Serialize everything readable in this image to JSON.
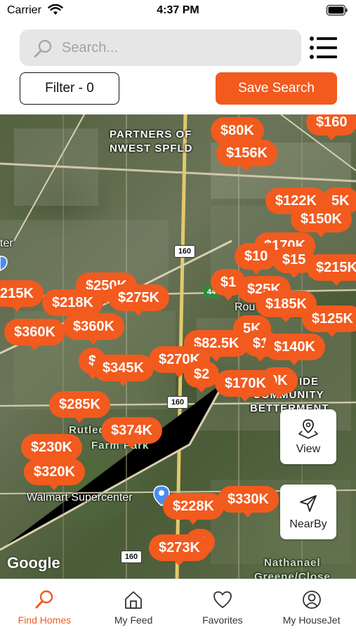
{
  "status_bar": {
    "carrier": "Carrier",
    "time": "4:37 PM"
  },
  "search": {
    "placeholder": "Search..."
  },
  "filter": {
    "label": "Filter  - 0"
  },
  "save_search": {
    "label": "Save Search"
  },
  "map": {
    "labels": {
      "partners_line1": "PARTNERS OF",
      "partners_line2": "NWEST SPFLD",
      "ter": "ter",
      "rou": "Rou",
      "ide": "IDE",
      "community": "COMMUNITY",
      "betterment": "BETTERMENT",
      "rutled": "Rutled",
      "farm_park": "Farm Park",
      "walmart": "Walmart Supercenter",
      "nathanael": "Nathanael",
      "greene_close": "Greene/Close"
    },
    "highways": {
      "h160_a": "160",
      "h160_b": "160",
      "h160_c": "160",
      "h44": "44"
    },
    "attribution": "Google",
    "pins": [
      {
        "id": "p1",
        "price": "$80K"
      },
      {
        "id": "p2",
        "price": "$160"
      },
      {
        "id": "p3",
        "price": "$156K"
      },
      {
        "id": "p4",
        "price": "$122K"
      },
      {
        "id": "p5",
        "price": "5K"
      },
      {
        "id": "p6",
        "price": "$150K"
      },
      {
        "id": "p7",
        "price": "$170K"
      },
      {
        "id": "p8",
        "price": "$10"
      },
      {
        "id": "p9",
        "price": "$15"
      },
      {
        "id": "p10",
        "price": "$215K"
      },
      {
        "id": "p11",
        "price": "$250K"
      },
      {
        "id": "p12",
        "price": "$1"
      },
      {
        "id": "p13",
        "price": "$25K"
      },
      {
        "id": "p14",
        "price": "215K"
      },
      {
        "id": "p15",
        "price": "$218K"
      },
      {
        "id": "p16",
        "price": "$275K"
      },
      {
        "id": "p17",
        "price": "$185K"
      },
      {
        "id": "p18",
        "price": "$125K"
      },
      {
        "id": "p19",
        "price": "$360K"
      },
      {
        "id": "p20",
        "price": "$360K"
      },
      {
        "id": "p21",
        "price": "5K"
      },
      {
        "id": "p22",
        "price": "$82.5K"
      },
      {
        "id": "p23",
        "price": "$1"
      },
      {
        "id": "p24",
        "price": "$140K"
      },
      {
        "id": "p25",
        "price": "$"
      },
      {
        "id": "p26",
        "price": "$345K"
      },
      {
        "id": "p27",
        "price": "$270K"
      },
      {
        "id": "p28",
        "price": "$2"
      },
      {
        "id": "p29",
        "price": "0K"
      },
      {
        "id": "p30",
        "price": "$170K"
      },
      {
        "id": "p31",
        "price": "$285K"
      },
      {
        "id": "p32",
        "price": "$374K"
      },
      {
        "id": "p33",
        "price": "$230K"
      },
      {
        "id": "p34",
        "price": "$320K"
      },
      {
        "id": "p35",
        "price": "$330K"
      },
      {
        "id": "p36",
        "price": "$228K"
      },
      {
        "id": "p37",
        "price": "K"
      },
      {
        "id": "p38",
        "price": "$273K"
      }
    ],
    "view_button": {
      "label": "View",
      "icon": "layers-icon"
    },
    "nearby_button": {
      "label": "NearBy",
      "icon": "navigation-arrow-icon"
    }
  },
  "tabs": [
    {
      "label": "Find Homes",
      "icon": "search-icon",
      "active": true
    },
    {
      "label": "My Feed",
      "icon": "home-icon",
      "active": false
    },
    {
      "label": "Favorites",
      "icon": "heart-icon",
      "active": false
    },
    {
      "label": "My HouseJet",
      "icon": "user-icon",
      "active": false
    }
  ],
  "colors": {
    "accent": "#f25a1e",
    "search_bg": "#e6e6e6"
  }
}
